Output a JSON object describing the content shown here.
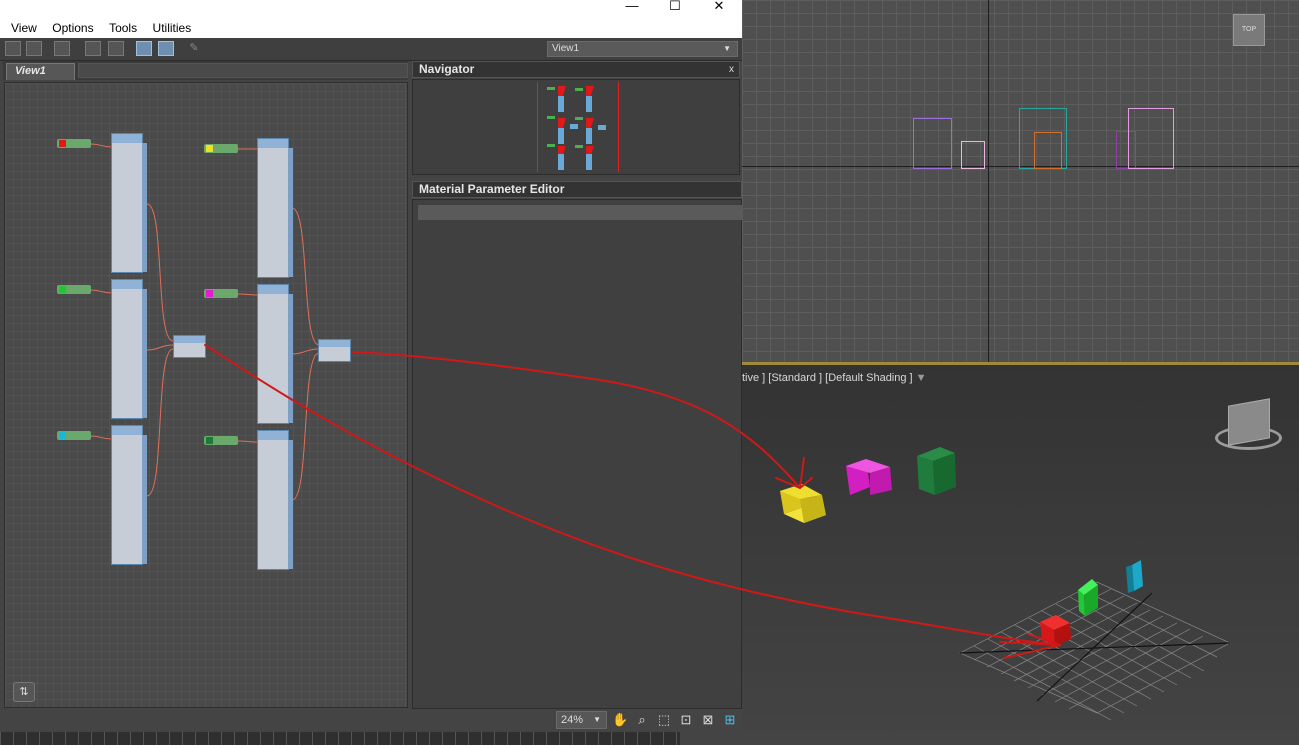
{
  "window": {
    "minimize_glyph": "—",
    "maximize_glyph": "☐",
    "close_glyph": "✕"
  },
  "menu": [
    "View",
    "Options",
    "Tools",
    "Utilities"
  ],
  "toolbar": {
    "view_select": "View1",
    "icons": [
      "select-icon",
      "pick-material-icon",
      "material-id-icon",
      "layout-icon",
      "hierarchy-icon",
      "show-map-icon",
      "show-background-icon",
      "eyedropper-icon"
    ]
  },
  "view_tab": {
    "label": "View1"
  },
  "navigator": {
    "title": "Navigator",
    "close_glyph": "x"
  },
  "material_parameter_editor": {
    "title": "Material Parameter Editor"
  },
  "statusbar": {
    "zoom": "24%"
  },
  "viewport_persp": {
    "label": "tive ] [Standard ] [Default Shading ]"
  },
  "viewcube": {
    "label": "TOP"
  },
  "colors": {
    "red": "#e01818",
    "yellow": "#f0e020",
    "green": "#1ec832",
    "magenta": "#e020d0",
    "teal": "#18b8d8",
    "dark_green": "#1c7a3a",
    "annotation_red": "#d01818"
  }
}
